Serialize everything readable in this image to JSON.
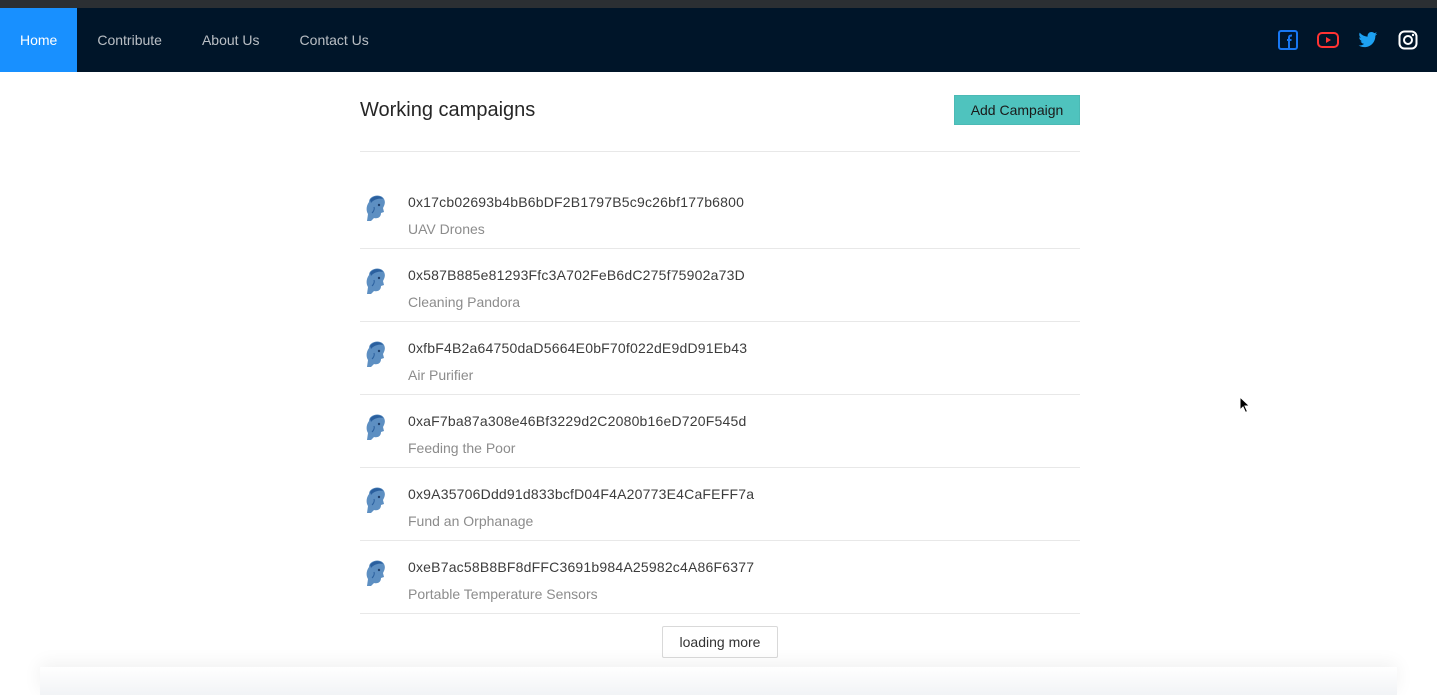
{
  "nav": {
    "items": [
      {
        "label": "Home",
        "active": true
      },
      {
        "label": "Contribute",
        "active": false
      },
      {
        "label": "About Us",
        "active": false
      },
      {
        "label": "Contact Us",
        "active": false
      }
    ],
    "social": [
      "facebook-icon",
      "youtube-icon",
      "twitter-icon",
      "instagram-icon"
    ]
  },
  "colors": {
    "navbar": "#001529",
    "active": "#1890ff",
    "add_button": "#4fc3be",
    "facebook": "#1877f2",
    "youtube": "#ff0000",
    "twitter": "#1da1f2",
    "instagram": "#ffffff"
  },
  "main": {
    "title": "Working campaigns",
    "add_button": "Add Campaign",
    "campaigns": [
      {
        "address": "0x17cb02693b4bB6bDF2B1797B5c9c26bf177b6800",
        "name": "UAV Drones"
      },
      {
        "address": "0x587B885e81293Ffc3A702FeB6dC275f75902a73D",
        "name": "Cleaning Pandora"
      },
      {
        "address": "0xfbF4B2a64750daD5664E0bF70f022dE9dD91Eb43",
        "name": "Air Purifier"
      },
      {
        "address": "0xaF7ba87a308e46Bf3229d2C2080b16eD720F545d",
        "name": "Feeding the Poor"
      },
      {
        "address": "0x9A35706Ddd91d833bcfD04F4A20773E4CaFEFF7a",
        "name": "Fund an Orphanage"
      },
      {
        "address": "0xeB7ac58B8BF8dFFC3691b984A25982c4A86F6377",
        "name": "Portable Temperature Sensors"
      }
    ],
    "load_more": "loading more"
  }
}
